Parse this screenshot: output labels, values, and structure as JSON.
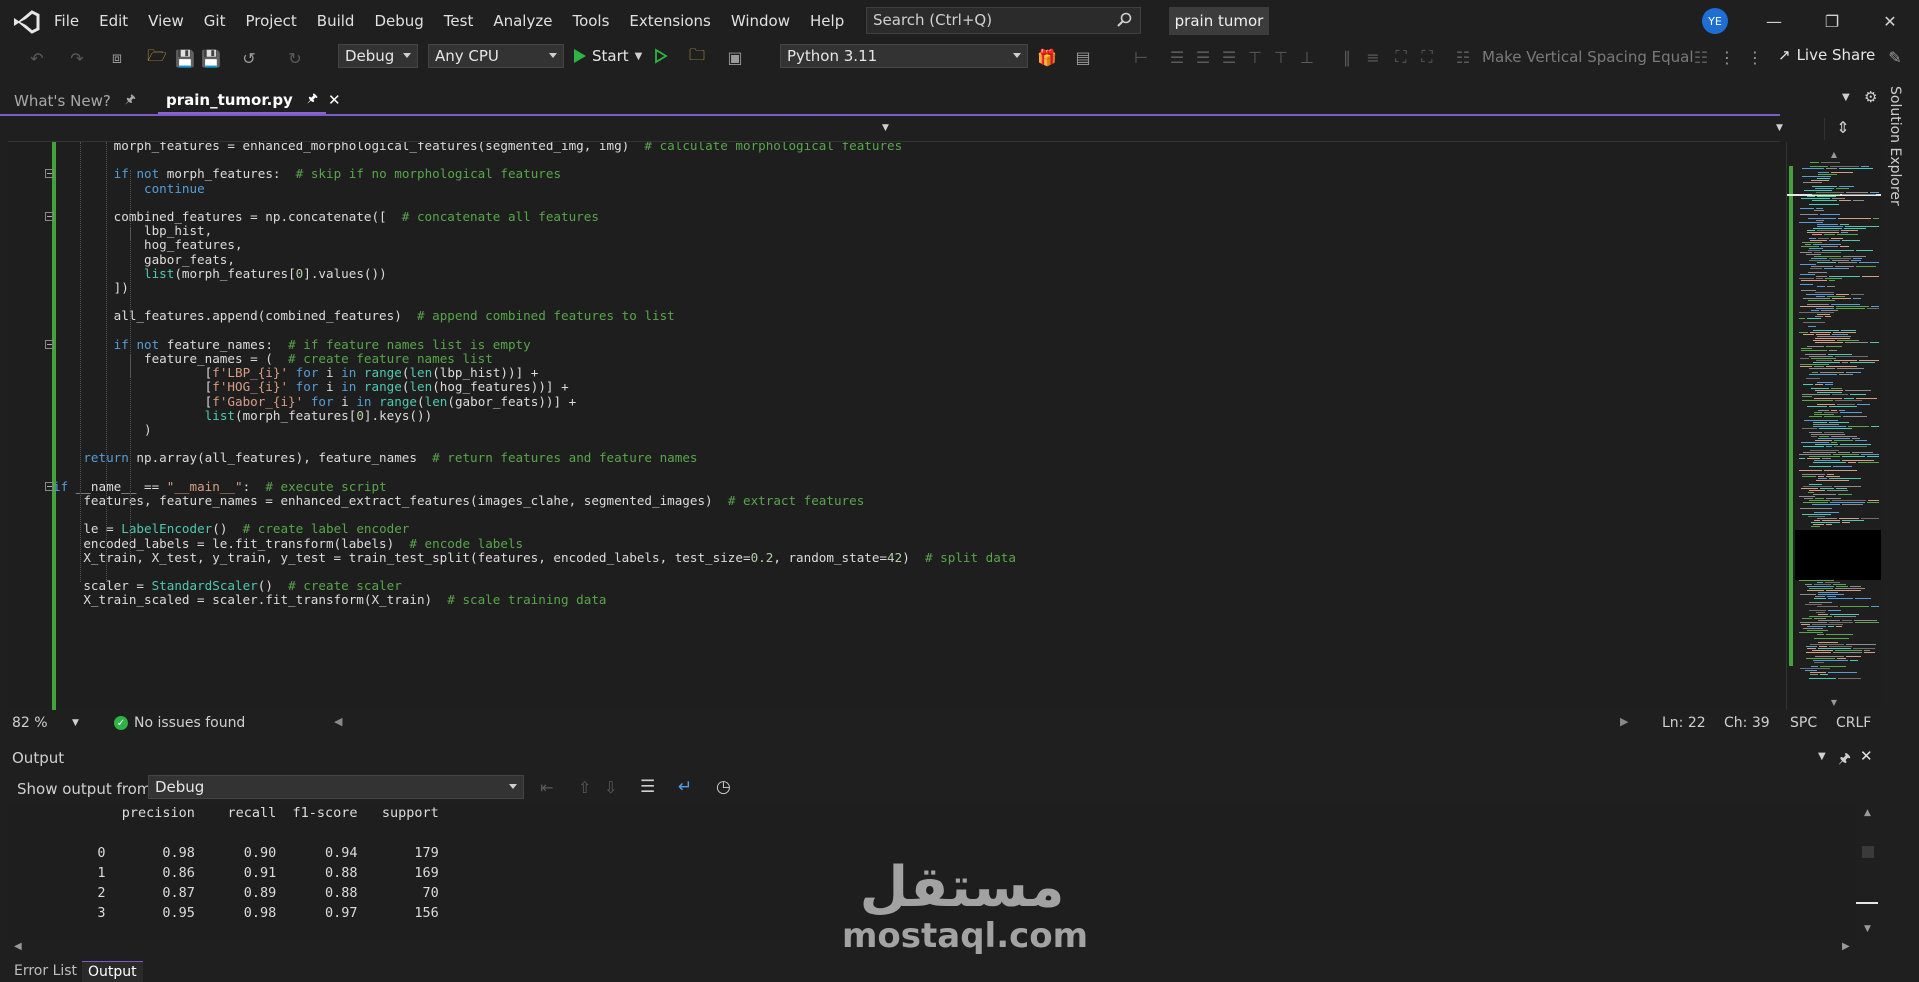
{
  "menu": [
    "File",
    "Edit",
    "View",
    "Git",
    "Project",
    "Build",
    "Debug",
    "Test",
    "Analyze",
    "Tools",
    "Extensions",
    "Window",
    "Help"
  ],
  "search": {
    "placeholder": "Search (Ctrl+Q)"
  },
  "project_name": "prain tumor",
  "user_initials": "YE",
  "toolbar": {
    "config": "Debug",
    "platform": "Any CPU",
    "start_label": "Start",
    "interpreter": "Python 3.11",
    "vertical_spacing": "Make Vertical Spacing Equal",
    "live_share": "Live Share"
  },
  "tabs": [
    {
      "label": "What's New?",
      "active": false
    },
    {
      "label": "prain_tumor.py",
      "active": true
    }
  ],
  "side_panel": "Solution Explorer",
  "code_lines": [
    "        morph_features = enhanced_morphological_features(segmented_img, img)  # calculate morphological features",
    "",
    "        if not morph_features:  # skip if no morphological features",
    "            continue",
    "",
    "        combined_features = np.concatenate([  # concatenate all features",
    "            lbp_hist,",
    "            hog_features,",
    "            gabor_feats,",
    "            list(morph_features[0].values())",
    "        ])",
    "",
    "        all_features.append(combined_features)  # append combined features to list",
    "",
    "        if not feature_names:  # if feature names list is empty",
    "            feature_names = (  # create feature names list",
    "                    [f'LBP_{i}' for i in range(len(lbp_hist))] +",
    "                    [f'HOG_{i}' for i in range(len(hog_features))] +",
    "                    [f'Gabor_{i}' for i in range(len(gabor_feats))] +",
    "                    list(morph_features[0].keys())",
    "            )",
    "",
    "    return np.array(all_features), feature_names  # return features and feature names",
    "",
    "if __name__ == \"__main__\":  # execute script",
    "    features, feature_names = enhanced_extract_features(images_clahe, segmented_images)  # extract features",
    "",
    "    le = LabelEncoder()  # create label encoder",
    "    encoded_labels = le.fit_transform(labels)  # encode labels",
    "    X_train, X_test, y_train, y_test = train_test_split(features, encoded_labels, test_size=0.2, random_state=42)  # split data",
    "",
    "    scaler = StandardScaler()  # create scaler",
    "    X_train_scaled = scaler.fit_transform(X_train)  # scale training data"
  ],
  "status": {
    "zoom": "82 %",
    "issues": "No issues found",
    "line": "Ln: 22",
    "col": "Ch: 39",
    "spaces": "SPC",
    "eol": "CRLF"
  },
  "output": {
    "title": "Output",
    "show_from_label": "Show output from:",
    "source": "Debug",
    "header": "              precision    recall  f1-score   support",
    "rows": [
      "",
      "           0       0.98      0.90      0.94       179",
      "           1       0.86      0.91      0.88       169",
      "           2       0.87      0.89      0.88        70",
      "           3       0.95      0.98      0.97       156"
    ]
  },
  "bottom_tabs": [
    "Error List",
    "Output"
  ],
  "watermark": {
    "arabic": "مستقل",
    "latin": "mostaql.com"
  }
}
